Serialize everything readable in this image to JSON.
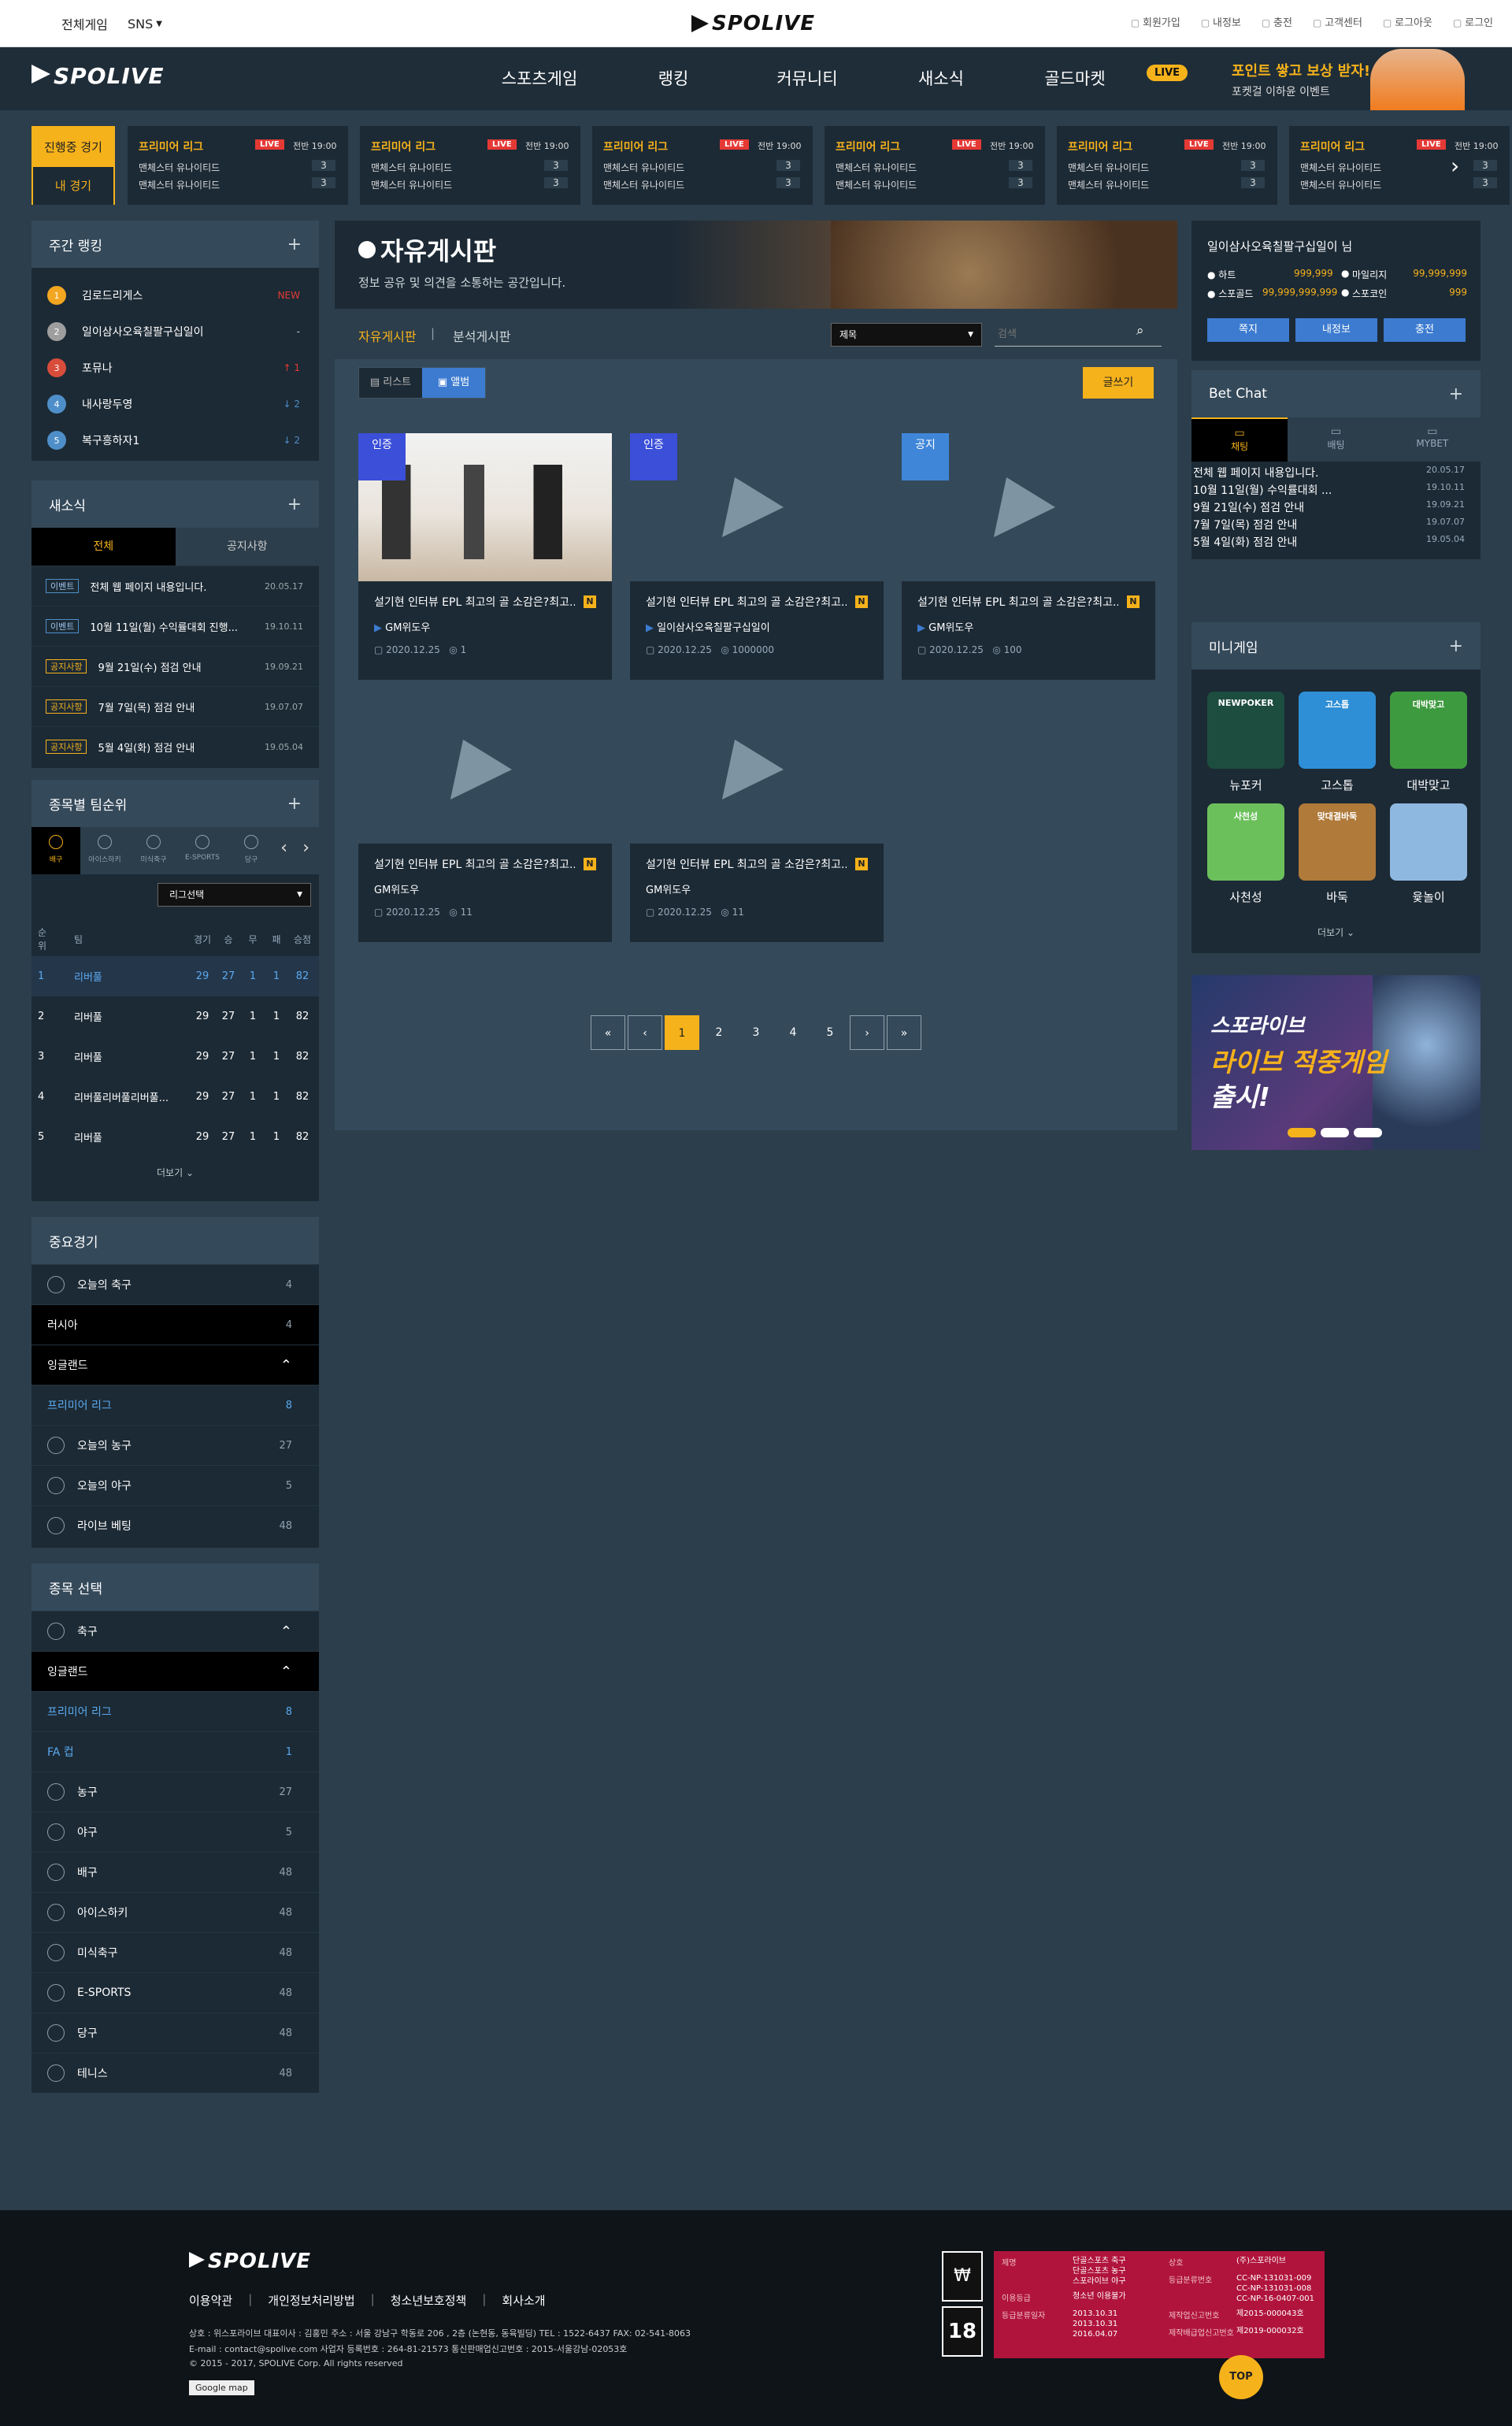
{
  "topbar": {
    "all_games": "전체게임",
    "sns": "SNS",
    "logo": "SPOLIVE",
    "util": [
      "회원가입",
      "내정보",
      "충전",
      "고객센터",
      "로그아웃",
      "로그인"
    ]
  },
  "nav": {
    "logo": "SPOLIVE",
    "menu": [
      "스포츠게임",
      "랭킹",
      "커뮤니티",
      "새소식",
      "골드마켓"
    ],
    "live_badge": "LIVE",
    "promo_title": "포인트 쌓고 보상 받자!",
    "promo_sub": "포켓걸 이하윤 이벤트"
  },
  "match_strip": {
    "live_label": "진행중 경기",
    "my_label": "내 경기",
    "cards": [
      {
        "league": "프리미어 리그",
        "live": "LIVE",
        "time": "전반 19:00",
        "team1": "맨체스터 유나이티드",
        "score1": "3",
        "team2": "맨체스터 유나이티드",
        "score2": "3"
      },
      {
        "league": "프리미어 리그",
        "live": "LIVE",
        "time": "전반 19:00",
        "team1": "맨체스터 유나이티드",
        "score1": "3",
        "team2": "맨체스터 유나이티드",
        "score2": "3"
      },
      {
        "league": "프리미어 리그",
        "live": "LIVE",
        "time": "전반 19:00",
        "team1": "맨체스터 유나이티드",
        "score1": "3",
        "team2": "맨체스터 유나이티드",
        "score2": "3"
      },
      {
        "league": "프리미어 리그",
        "live": "LIVE",
        "time": "전반 19:00",
        "team1": "맨체스터 유나이티드",
        "score1": "3",
        "team2": "맨체스터 유나이티드",
        "score2": "3"
      },
      {
        "league": "프리미어 리그",
        "live": "LIVE",
        "time": "전반 19:00",
        "team1": "맨체스터 유나이티드",
        "score1": "3",
        "team2": "맨체스터 유나이티드",
        "score2": "3"
      },
      {
        "league": "프리미어 리그",
        "live": "LIVE",
        "time": "전반 19:00",
        "team1": "맨체스터 유나이티드",
        "score1": "3",
        "team2": "맨체스터 유나이티드",
        "score2": "3"
      }
    ]
  },
  "weekly_rank": {
    "title": "주간 랭킹",
    "items": [
      {
        "rank": "1",
        "name": "김로드리게스",
        "change": "NEW",
        "color": "#f3a621"
      },
      {
        "rank": "2",
        "name": "일이삼사오육칠팔구십일이",
        "change": "-",
        "color": "#9e9e9e"
      },
      {
        "rank": "3",
        "name": "포뮤나",
        "change": "↑ 1",
        "color": "#d84c3c"
      },
      {
        "rank": "4",
        "name": "내사랑두영",
        "change": "↓ 2",
        "color": "#4f8fc9"
      },
      {
        "rank": "5",
        "name": "복구흥하자1",
        "change": "↓ 2",
        "color": "#4f8fc9"
      }
    ]
  },
  "news": {
    "title": "새소식",
    "tab_all": "전체",
    "tab_notice": "공지사항",
    "items": [
      {
        "tag": "이벤트",
        "text": "전체 웹 페이지 내용입니다.",
        "date": "20.05.17"
      },
      {
        "tag": "이벤트",
        "text": "10월 11일(월) 수익률대회 진행...",
        "date": "19.10.11"
      },
      {
        "tag": "공지사항",
        "text": "9월 21일(수) 점검 안내",
        "date": "19.09.21"
      },
      {
        "tag": "공지사항",
        "text": "7월 7일(목) 점검 안내",
        "date": "19.07.07"
      },
      {
        "tag": "공지사항",
        "text": "5월 4일(화) 점검 안내",
        "date": "19.05.04"
      }
    ]
  },
  "team_rank": {
    "title": "종목별 팀순위",
    "sports": [
      "배구",
      "아이스하키",
      "미식축구",
      "E-SPORTS",
      "당구"
    ],
    "select": "리그선택",
    "headers": [
      "순위",
      "팀",
      "경기",
      "승",
      "무",
      "패",
      "승점"
    ],
    "rows": [
      [
        "1",
        "리버풀",
        "29",
        "27",
        "1",
        "1",
        "82"
      ],
      [
        "2",
        "리버풀",
        "29",
        "27",
        "1",
        "1",
        "82"
      ],
      [
        "3",
        "리버풀",
        "29",
        "27",
        "1",
        "1",
        "82"
      ],
      [
        "4",
        "리버풀리버풀리버풀...",
        "29",
        "27",
        "1",
        "1",
        "82"
      ],
      [
        "5",
        "리버풀",
        "29",
        "27",
        "1",
        "1",
        "82"
      ]
    ],
    "more": "더보기"
  },
  "important": {
    "title": "중요경기",
    "rows": [
      {
        "label": "오늘의 축구",
        "count": "4",
        "type": "sport"
      },
      {
        "label": "러시아",
        "count": "4",
        "type": "dark"
      },
      {
        "label": "잉글랜드",
        "count": "",
        "type": "dark-open"
      },
      {
        "label": "프리미어 리그",
        "count": "8",
        "type": "blue"
      },
      {
        "label": "오늘의 농구",
        "count": "27",
        "type": "sport"
      },
      {
        "label": "오늘의 야구",
        "count": "5",
        "type": "sport"
      },
      {
        "label": "라이브 베팅",
        "count": "48",
        "type": "sport"
      }
    ]
  },
  "select_sport": {
    "title": "종목 선택",
    "rows": [
      {
        "label": "축구",
        "count": "",
        "type": "sport-open"
      },
      {
        "label": "잉글랜드",
        "count": "",
        "type": "dark-open"
      },
      {
        "label": "프리미어 리그",
        "count": "8",
        "type": "blue"
      },
      {
        "label": "FA 컵",
        "count": "1",
        "type": "blue"
      },
      {
        "label": "농구",
        "count": "27",
        "type": "sport"
      },
      {
        "label": "야구",
        "count": "5",
        "type": "sport"
      },
      {
        "label": "배구",
        "count": "48",
        "type": "sport"
      },
      {
        "label": "아이스하키",
        "count": "48",
        "type": "sport"
      },
      {
        "label": "미식축구",
        "count": "48",
        "type": "sport"
      },
      {
        "label": "E-SPORTS",
        "count": "48",
        "type": "sport"
      },
      {
        "label": "당구",
        "count": "48",
        "type": "sport"
      },
      {
        "label": "테니스",
        "count": "48",
        "type": "sport"
      }
    ]
  },
  "board": {
    "title": "자유게시판",
    "subtitle": "정보 공유 및 의견을 소통하는 공간입니다.",
    "tab_free": "자유게시판",
    "tab_analysis": "분석게시판",
    "search_select": "제목",
    "search_placeholder": "검색",
    "view_list": "리스트",
    "view_album": "앨범",
    "write": "글쓰기",
    "cards": [
      {
        "badge": "인증",
        "badge_color": "#3b4fd8",
        "title": "설기현 인터뷰 EPL 최고의 골 소감은?최고...",
        "author": "GM위도우",
        "date": "2020.12.25",
        "views": "1",
        "has_image": true,
        "has_icon": true
      },
      {
        "badge": "인증",
        "badge_color": "#3b4fd8",
        "title": "설기현 인터뷰 EPL 최고의 골 소감은?최고...",
        "author": "일이삼사오육칠팔구십일이",
        "date": "2020.12.25",
        "views": "1000000",
        "has_image": false,
        "has_icon": true
      },
      {
        "badge": "공지",
        "badge_color": "#3f86d9",
        "title": "설기현 인터뷰 EPL 최고의 골 소감은?최고...",
        "author": "GM위도우",
        "date": "2020.12.25",
        "views": "100",
        "has_image": false,
        "has_icon": true
      },
      {
        "badge": "",
        "badge_color": "",
        "title": "설기현 인터뷰 EPL 최고의 골 소감은?최고...",
        "author": "GM위도우",
        "date": "2020.12.25",
        "views": "11",
        "has_image": false,
        "has_icon": false
      },
      {
        "badge": "",
        "badge_color": "",
        "title": "설기현 인터뷰 EPL 최고의 골 소감은?최고...",
        "author": "GM위도우",
        "date": "2020.12.25",
        "views": "11",
        "has_image": false,
        "has_icon": false
      }
    ],
    "new_mark": "N",
    "pages": [
      "1",
      "2",
      "3",
      "4",
      "5"
    ],
    "current_page": "1"
  },
  "user": {
    "name": "일이삼사오육칠팔구십일이 님",
    "hearts_label": "하트",
    "hearts": "999,999",
    "mileage_label": "마일리지",
    "mileage": "99,999,999",
    "gold_label": "스포골드",
    "gold": "99,999,999,999",
    "coin_label": "스포코인",
    "coin": "999",
    "btn_note": "쪽지",
    "btn_info": "내정보",
    "btn_charge": "충전"
  },
  "betchat": {
    "title": "Bet Chat",
    "tabs": [
      "채팅",
      "배팅",
      "MYBET"
    ],
    "items": [
      {
        "text": "전체 웹 페이지 내용입니다.",
        "date": "20.05.17"
      },
      {
        "text": "10월 11일(월) 수익률대회 ...",
        "date": "19.10.11"
      },
      {
        "text": "9월 21일(수) 점검 안내",
        "date": "19.09.21"
      },
      {
        "text": "7월 7일(목) 점검 안내",
        "date": "19.07.07"
      },
      {
        "text": "5월 4일(화) 점검 안내",
        "date": "19.05.04"
      }
    ]
  },
  "minigame": {
    "title": "미니게임",
    "games": [
      {
        "name": "뉴포커",
        "color": "#1d4d3f",
        "label": "NEWPOKER"
      },
      {
        "name": "고스톱",
        "color": "#2e8fd6",
        "label": "고스톱"
      },
      {
        "name": "대박맞고",
        "color": "#3e9a3e",
        "label": "대박맞고"
      },
      {
        "name": "사천성",
        "color": "#6cc05c",
        "label": "사천성"
      },
      {
        "name": "바둑",
        "color": "#b07a3a",
        "label": "맞대결바둑"
      },
      {
        "name": "윷놀이",
        "color": "#8fb8e0",
        "label": ""
      }
    ],
    "more": "더보기"
  },
  "ad": {
    "line1": "스포라이브",
    "line2": "라이브 적중게임",
    "line3": "출시!"
  },
  "footer": {
    "logo": "SPOLIVE",
    "links": [
      "이용약관",
      "개인정보처리방법",
      "청소년보호정책",
      "회사소개"
    ],
    "info1": "상호 : 위스포라이브 대표이사 : 김홍민 주소 : 서울 강남구 학동로 206 , 2층 (논현동, 동육빌딩) TEL : 1522-6437 FAX: 02-541-8063",
    "info2": "E-mail : contact@spolive.com 사업자 등록번호 : 264-81-21573 통신판매업신고번호 : 2015-서울강남-02053호",
    "copy": "© 2015 - 2017, SPOLIVE Corp. All rights reserved",
    "gmap": "Google map",
    "rating_left": [
      [
        "제명",
        "단골스포츠 축구\n단골스포츠 농구\n스포라이브 야구"
      ],
      [
        "이용등급",
        "청소년 이용불가"
      ],
      [
        "등급분류일자",
        "2013.10.31\n2013.10.31\n2016.04.07"
      ]
    ],
    "rating_right": [
      [
        "상호",
        "(주)스포라이브"
      ],
      [
        "등급분류번호",
        "CC-NP-131031-009\nCC-NP-131031-008\nCC-NP-16-0407-001"
      ],
      [
        "제작업신고번호",
        "제2015-000043호"
      ],
      [
        "제작배급업신고번호",
        "제2019-000032호"
      ]
    ],
    "top": "TOP"
  }
}
